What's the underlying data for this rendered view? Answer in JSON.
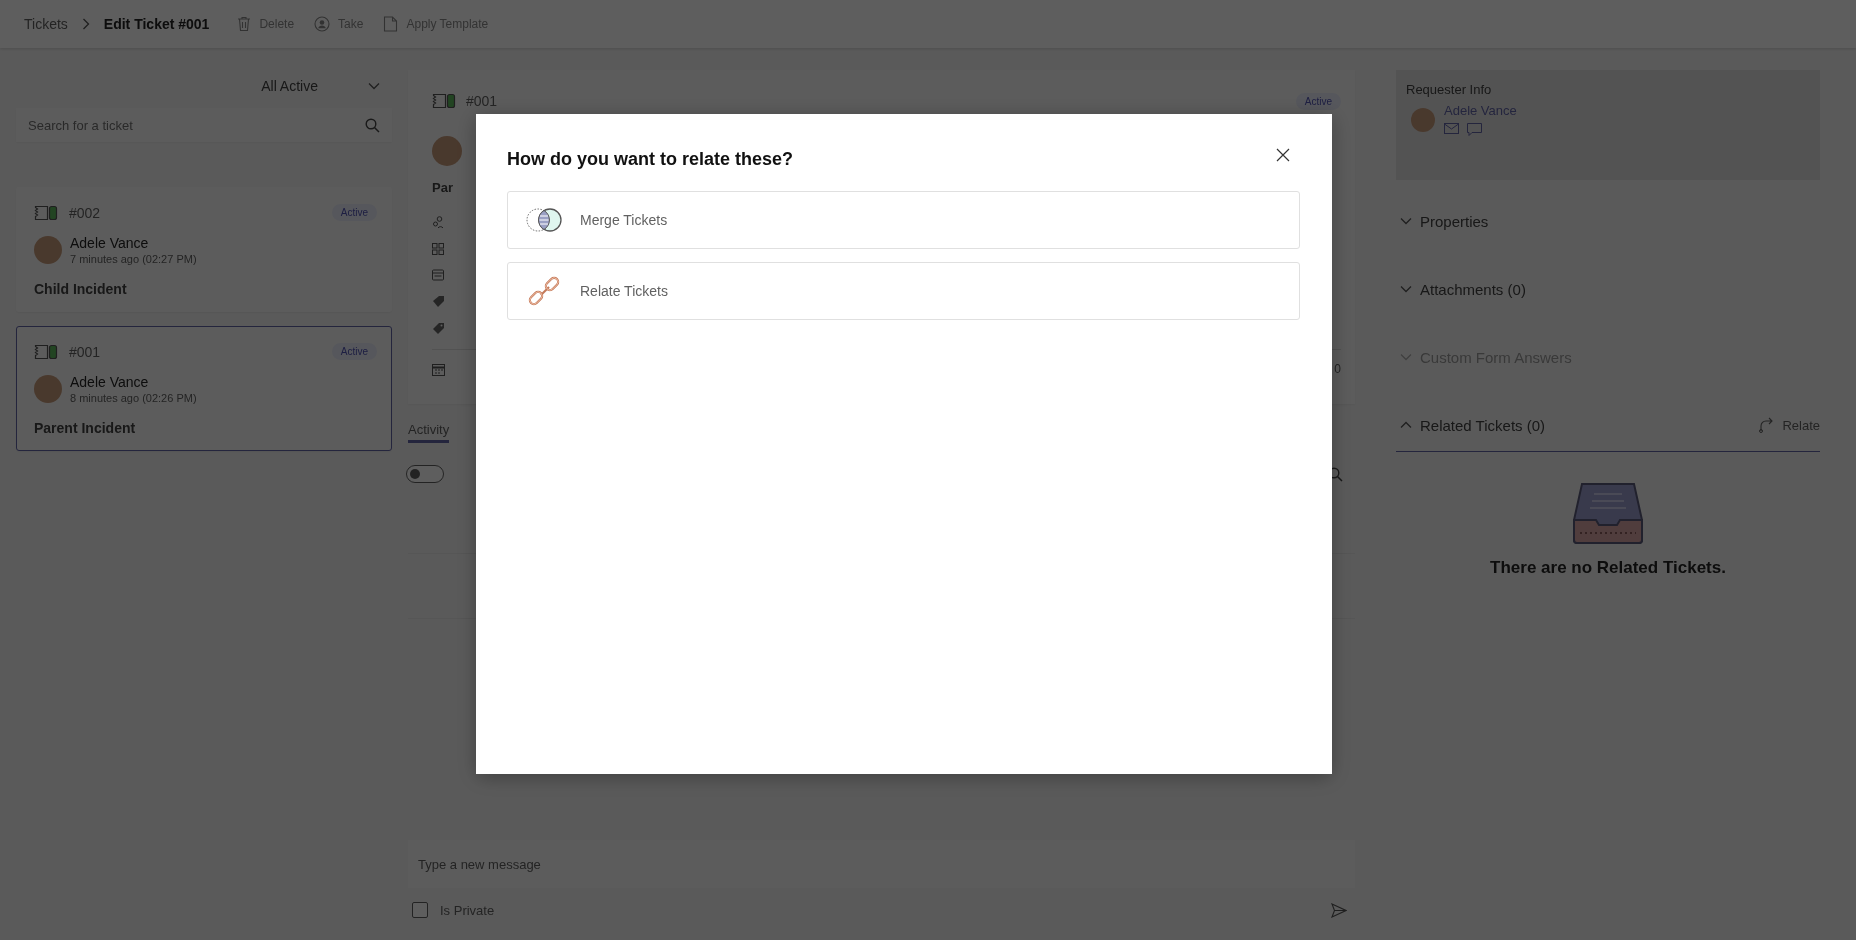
{
  "topbar": {
    "breadcrumb": [
      {
        "label": "Tickets",
        "current": false
      },
      {
        "label": "Edit Ticket #001",
        "current": true
      }
    ],
    "actions": [
      {
        "kind": "delete",
        "label": "Delete"
      },
      {
        "kind": "take",
        "label": "Take"
      },
      {
        "kind": "template",
        "label": "Apply Template"
      }
    ]
  },
  "ticket_list": {
    "filter": "All Active",
    "search": {
      "placeholder": "Search for a ticket"
    },
    "tickets": [
      {
        "number": "#002",
        "status": "Active",
        "requester": "Adele Vance",
        "time": "7 minutes ago (02:27 PM)",
        "title": "Child Incident",
        "selected": false
      },
      {
        "number": "#001",
        "status": "Active",
        "requester": "Adele Vance",
        "time": "8 minutes ago (02:26 PM)",
        "title": "Parent Incident",
        "selected": true
      }
    ]
  },
  "ticket_detail": {
    "number": "#001",
    "status": "Active",
    "title": "Par",
    "date": "0",
    "tabs": [
      {
        "label": "Activity",
        "selected": true
      }
    ],
    "toggle": {
      "on": false
    },
    "composer": {
      "placeholder": "Type a new message",
      "private": {
        "label": "Is Private",
        "checked": false
      }
    }
  },
  "sidebar": {
    "requester": {
      "title": "Requester Info",
      "name": "Adele Vance"
    },
    "sections": [
      {
        "label": "Properties",
        "expanded": false,
        "disabled": false
      },
      {
        "label": "Attachments (0)",
        "expanded": false,
        "disabled": false
      },
      {
        "label": "Custom Form Answers",
        "expanded": false,
        "disabled": true
      },
      {
        "label": "Related Tickets (0)",
        "expanded": true,
        "disabled": false,
        "action": "Relate"
      }
    ],
    "empty_message": "There are no Related Tickets."
  },
  "dialog": {
    "title": "How do you want to relate these?",
    "options": [
      {
        "kind": "merge",
        "label": "Merge Tickets"
      },
      {
        "kind": "relate",
        "label": "Relate Tickets"
      }
    ]
  }
}
